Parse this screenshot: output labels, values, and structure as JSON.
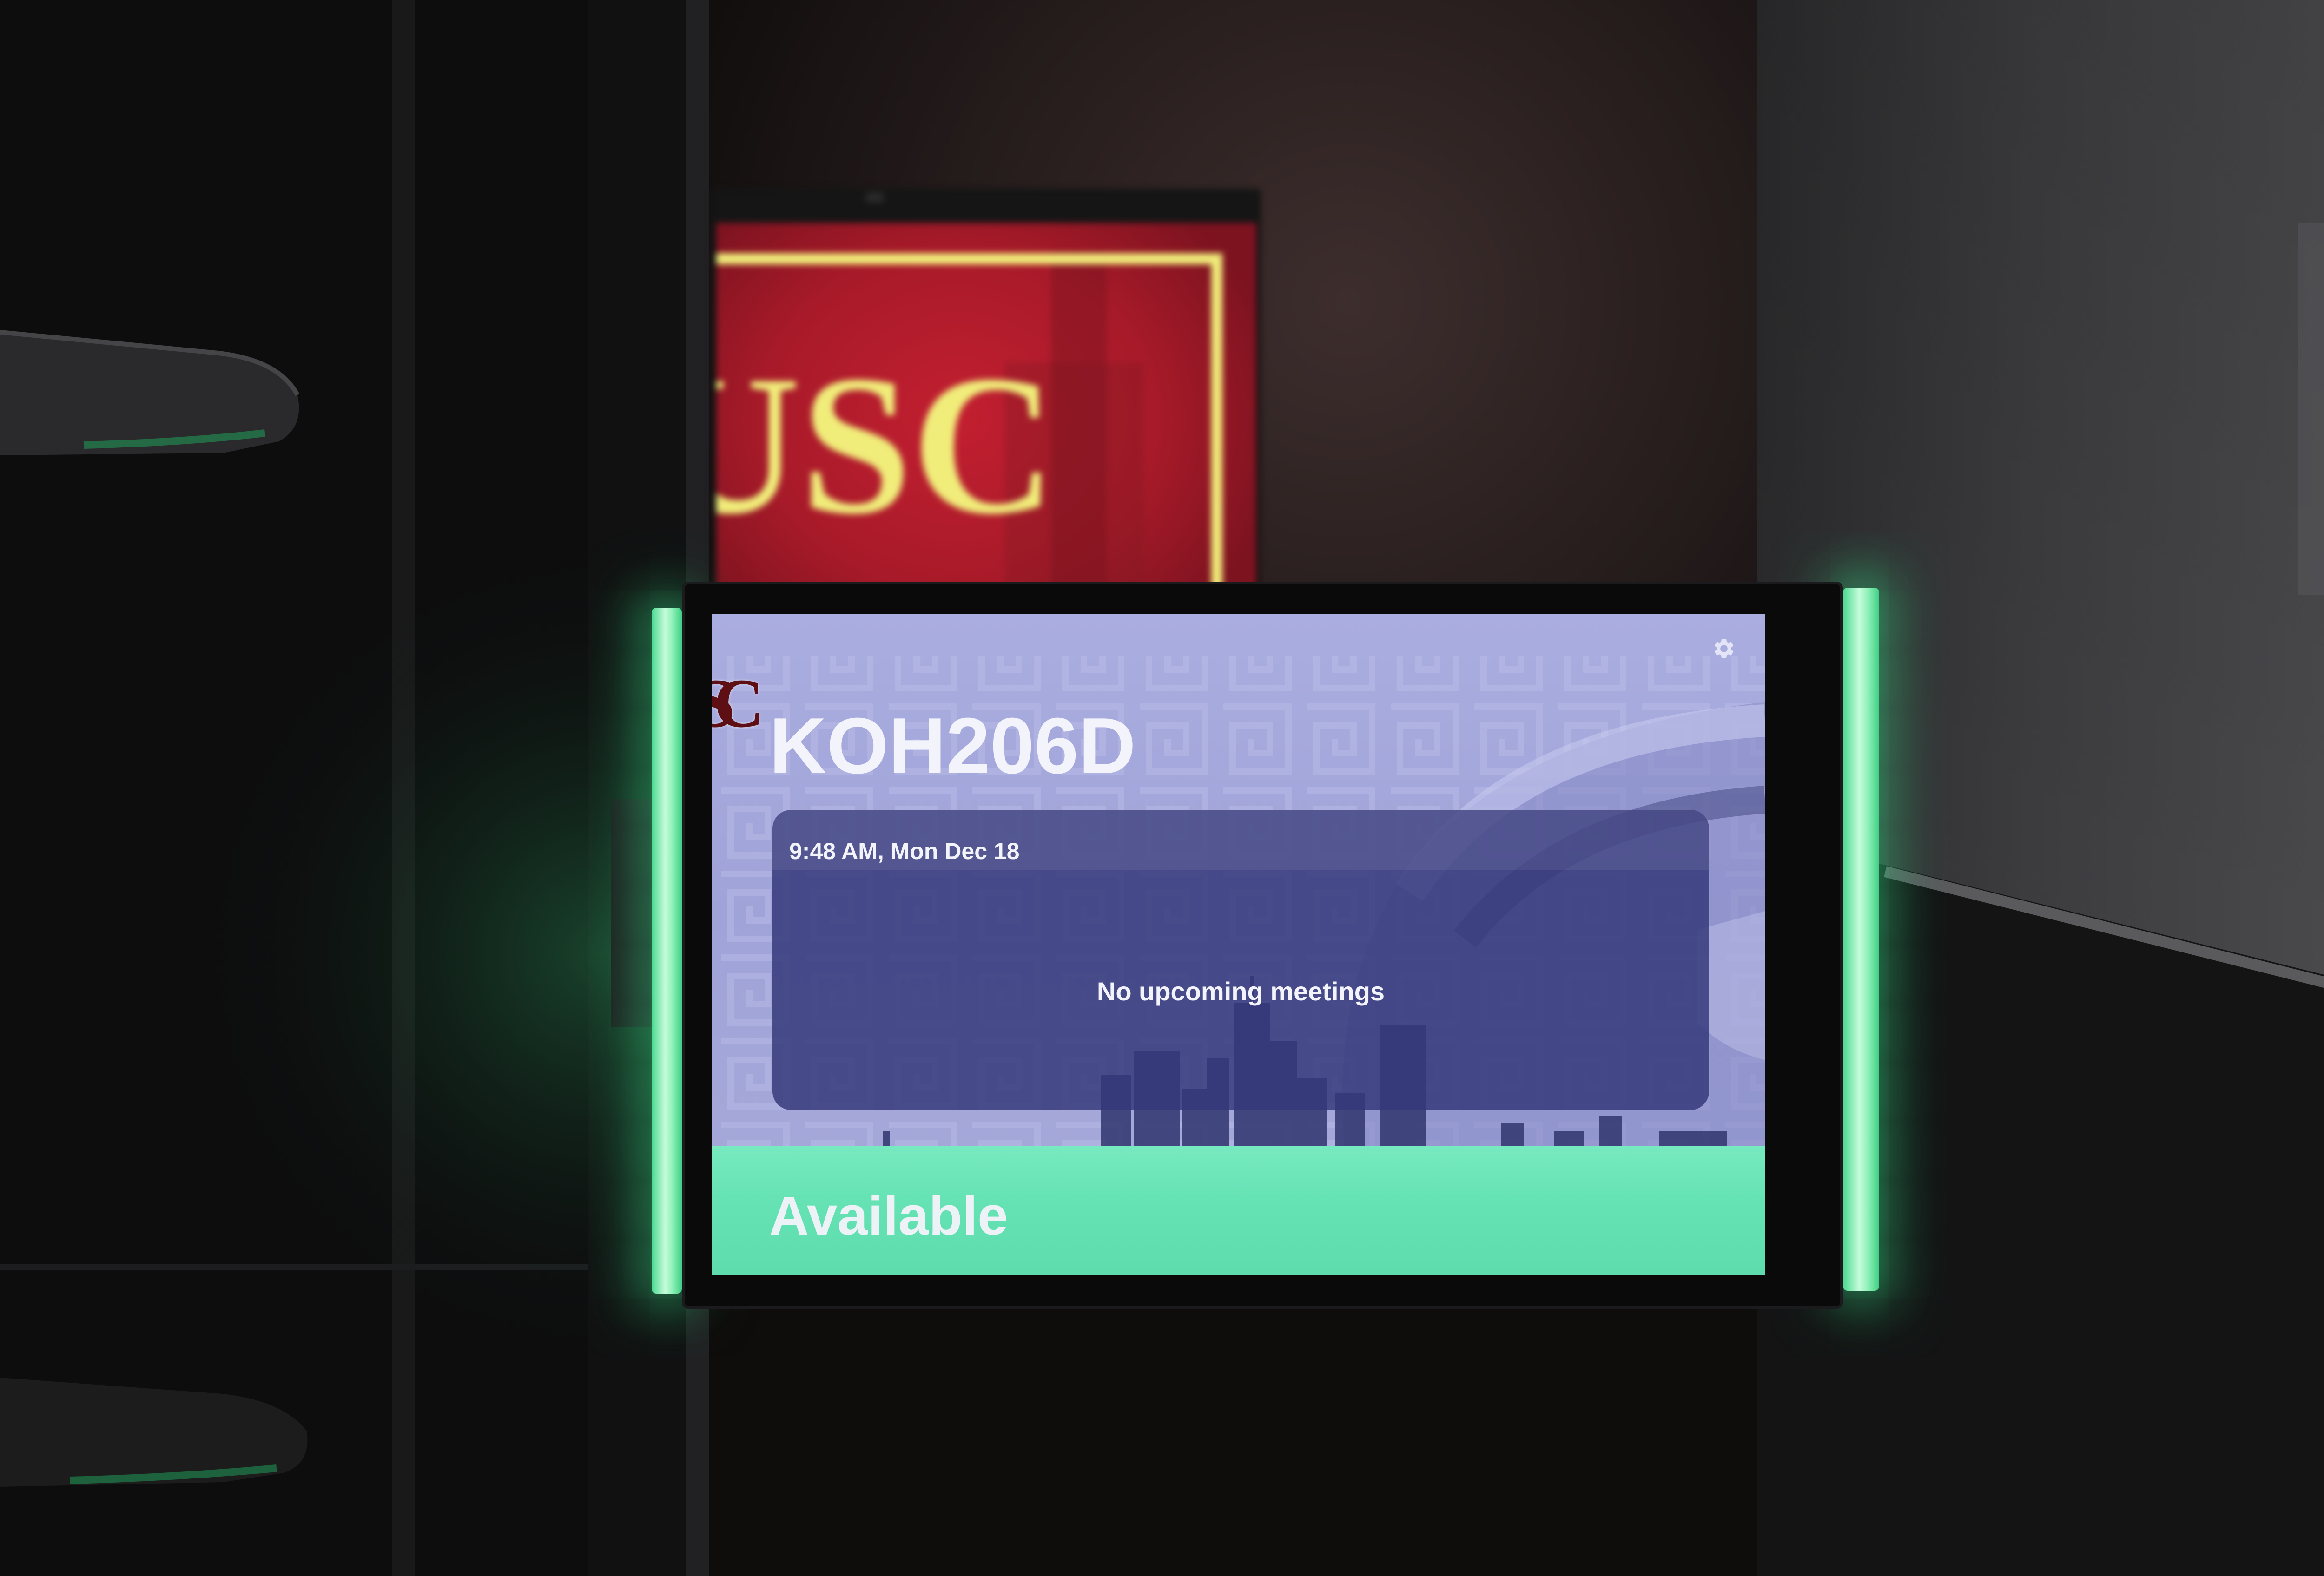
{
  "room": {
    "name": "KOH206D"
  },
  "header": {
    "logo_text": "SC",
    "settings_icon": "gear-icon"
  },
  "schedule": {
    "current_datetime": "9:48 AM, Mon Dec 18",
    "empty_message": "No upcoming meetings"
  },
  "status": {
    "label": "Available"
  },
  "background_sign": {
    "text": "USC"
  },
  "colors": {
    "status_green": "#66e3b5",
    "screen_lavender": "#a4a7db",
    "card_navy": "#3e4283",
    "usc_cardinal": "#c21f30",
    "usc_gold": "#f1ed7a",
    "logo_maroon": "#5e0f14"
  }
}
